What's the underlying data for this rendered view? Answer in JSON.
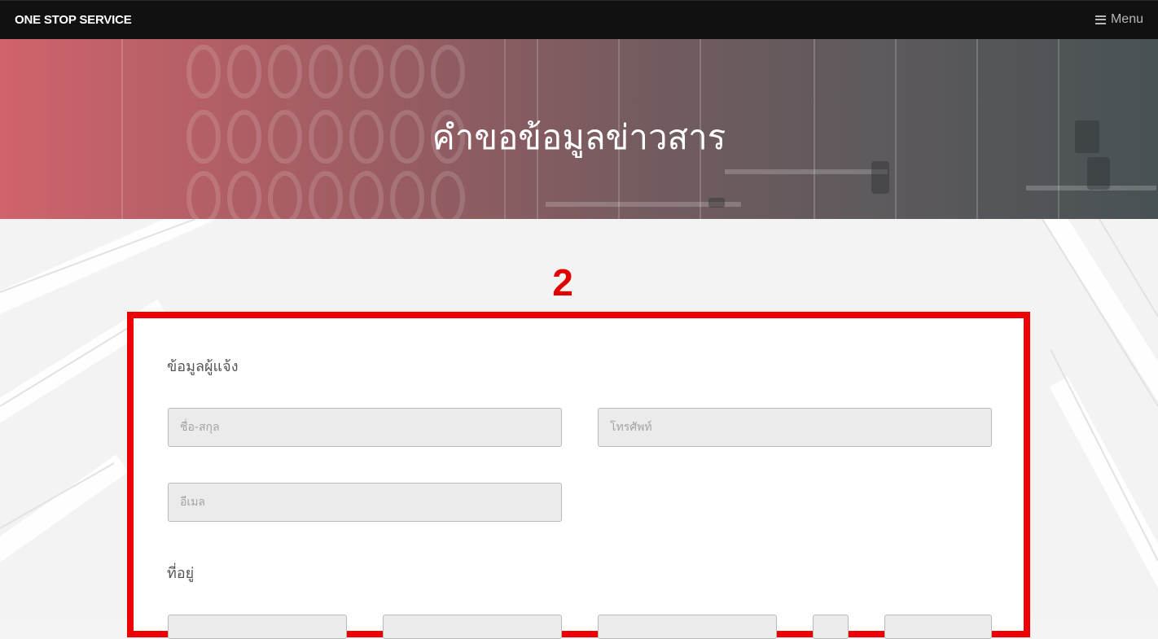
{
  "navbar": {
    "brand": "ONE STOP SERVICE",
    "menu_label": "Menu",
    "menu_icon": "bars-icon"
  },
  "hero": {
    "title": "คำขอข้อมูลข่าวสาร"
  },
  "step": {
    "number": "2",
    "highlight_color": "#ef0000"
  },
  "form": {
    "reporter_section": "ข้อมูลผู้แจ้ง",
    "name_placeholder": "ชื่อ-สกุล",
    "phone_placeholder": "โทรศัพท์",
    "email_placeholder": "อีเมล",
    "address_section": "ที่อยู่"
  }
}
